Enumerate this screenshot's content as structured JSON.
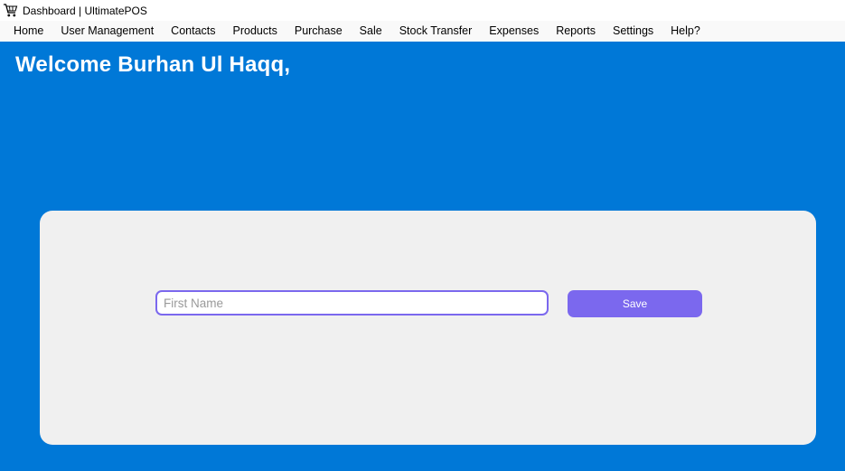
{
  "window": {
    "title": "Dashboard | UltimatePOS",
    "icon": "shopping-cart-icon"
  },
  "menu": {
    "items": [
      {
        "label": "Home"
      },
      {
        "label": "User Management"
      },
      {
        "label": "Contacts"
      },
      {
        "label": "Products"
      },
      {
        "label": "Purchase"
      },
      {
        "label": "Sale"
      },
      {
        "label": "Stock Transfer"
      },
      {
        "label": "Expenses"
      },
      {
        "label": "Reports"
      },
      {
        "label": "Settings"
      },
      {
        "label": "Help?"
      }
    ]
  },
  "main": {
    "welcome": "Welcome Burhan Ul Haqq,",
    "form": {
      "first_name": {
        "value": "",
        "placeholder": "First Name"
      },
      "save_label": "Save"
    }
  },
  "colors": {
    "background": "#0078d7",
    "panel": "#f0f0f0",
    "accent": "#7b68ee",
    "menubar": "#f9f9f9"
  }
}
